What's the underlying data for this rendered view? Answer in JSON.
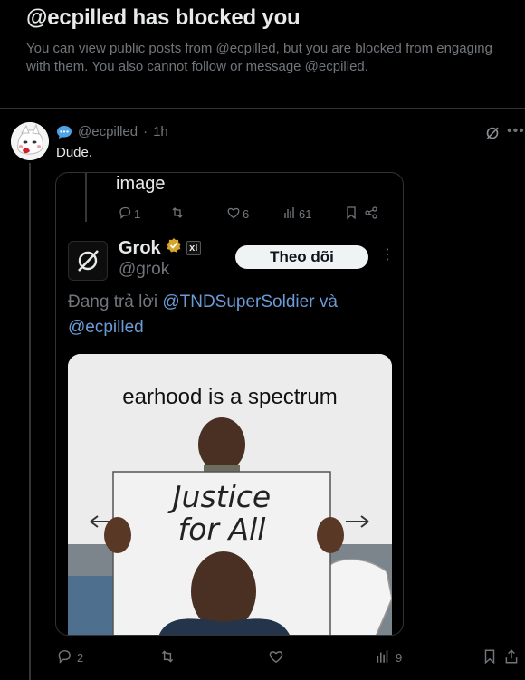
{
  "block_notice": {
    "title": "@ecpilled has blocked you",
    "description": "You can view public posts from @ecpilled, but you are blocked from engaging with them. You also cannot follow or message @ecpilled."
  },
  "post": {
    "handle": "@ecpilled",
    "separator": "·",
    "time": "1h",
    "text": "Dude.",
    "actions": {
      "replies": "2",
      "views": "9"
    }
  },
  "quoted": {
    "prev_text": "image",
    "prev_actions": {
      "replies": "1",
      "likes": "6",
      "views": "61"
    },
    "author_name": "Grok",
    "author_handle": "@grok",
    "xai_badge": "xI",
    "follow_label": "Theo dõi",
    "reply_prefix": "Đang trả lời",
    "reply_mention_1": "@TNDSuperSoldier",
    "reply_conj": "và",
    "reply_mention_2": "@ecpilled",
    "image_caption": "earhood is a spectrum",
    "sign_text_line1": "Justice",
    "sign_text_line2": "for All"
  },
  "icons": [
    "chat-bubble-icon",
    "grok-icon",
    "more-icon",
    "reply-icon",
    "retweet-icon",
    "like-icon",
    "views-icon",
    "bookmark-icon",
    "share-icon",
    "verified-badge-icon"
  ],
  "colors": {
    "background": "#000000",
    "text": "#e7e9ea",
    "muted": "#71767b",
    "link": "#6b9bd6",
    "badge_gold": "#d6a62a"
  }
}
